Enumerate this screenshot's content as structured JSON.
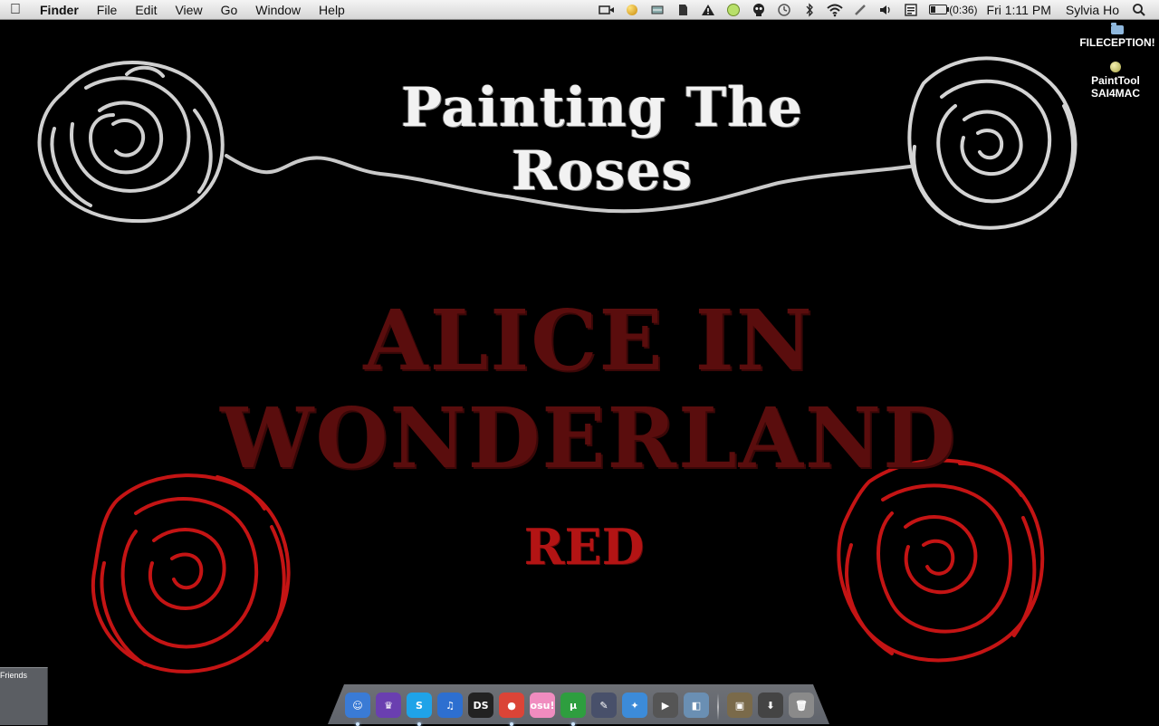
{
  "menubar": {
    "apple_icon": "apple-logo",
    "app_name": "Finder",
    "menus": [
      "File",
      "Edit",
      "View",
      "Go",
      "Window",
      "Help"
    ],
    "status_icons": [
      "video-camera-icon",
      "moon-icon",
      "scanner-icon",
      "evernote-icon",
      "warning-icon",
      "lime-icon",
      "alien-icon",
      "time-machine-icon",
      "bluetooth-icon",
      "wifi-icon",
      "pen-icon",
      "volume-icon",
      "calendar-icon"
    ],
    "battery_text": "(0:36)",
    "battery_level": 0.3,
    "clock": "Fri 1:11 PM",
    "user": "Sylvia Ho",
    "search_icon": "spotlight-icon"
  },
  "wallpaper": {
    "title": "Painting The Roses",
    "headline": "ALICE IN WONDERLAND",
    "subtext": "RED"
  },
  "desktop_icons": [
    {
      "label": "FILECEPTION!",
      "icon": "folder-icon"
    },
    {
      "label": "PaintTool SAI4MAC",
      "icon": "app-icon"
    }
  ],
  "chat_panel": {
    "label": "ok Friends"
  },
  "dock": {
    "apps": [
      {
        "name": "Finder",
        "glyph": "☺",
        "color": "#3a7bd5",
        "running": true
      },
      {
        "name": "Wizard",
        "glyph": "♛",
        "color": "#6a3fb0",
        "running": false
      },
      {
        "name": "Skype",
        "glyph": "S",
        "color": "#1fa3e8",
        "running": true
      },
      {
        "name": "iTunes",
        "glyph": "♫",
        "color": "#2d6fd0",
        "running": false
      },
      {
        "name": "DeSmuME",
        "glyph": "DS",
        "color": "#222222",
        "running": false
      },
      {
        "name": "Chrome",
        "glyph": "●",
        "color": "#db4437",
        "running": true
      },
      {
        "name": "osu!",
        "glyph": "osu!",
        "color": "#f08cbf",
        "running": false
      },
      {
        "name": "uTorrent",
        "glyph": "µ",
        "color": "#2e9e3f",
        "running": true
      },
      {
        "name": "Brush",
        "glyph": "✎",
        "color": "#48506a",
        "running": false
      },
      {
        "name": "Dashboard",
        "glyph": "✦",
        "color": "#3c8bd9",
        "running": false
      },
      {
        "name": "iMovie",
        "glyph": "▶",
        "color": "#555555",
        "running": false
      },
      {
        "name": "Preview",
        "glyph": "◧",
        "color": "#6a8fb3",
        "running": false
      }
    ],
    "stacks": [
      {
        "name": "Photos",
        "glyph": "▣",
        "color": "#7a6a4a"
      },
      {
        "name": "Downloads",
        "glyph": "⬇",
        "color": "#444444"
      },
      {
        "name": "Trash",
        "glyph": "🗑",
        "color": "#8a8a8a"
      }
    ]
  }
}
